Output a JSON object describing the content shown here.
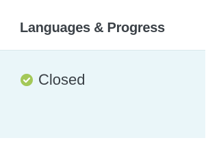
{
  "header": {
    "title": "Languages & Progress"
  },
  "status": {
    "label": "Closed",
    "icon": "check-circle-icon",
    "icon_color": "#a3c858"
  },
  "colors": {
    "body_background": "#eaf6f9",
    "text": "#3b4147"
  }
}
